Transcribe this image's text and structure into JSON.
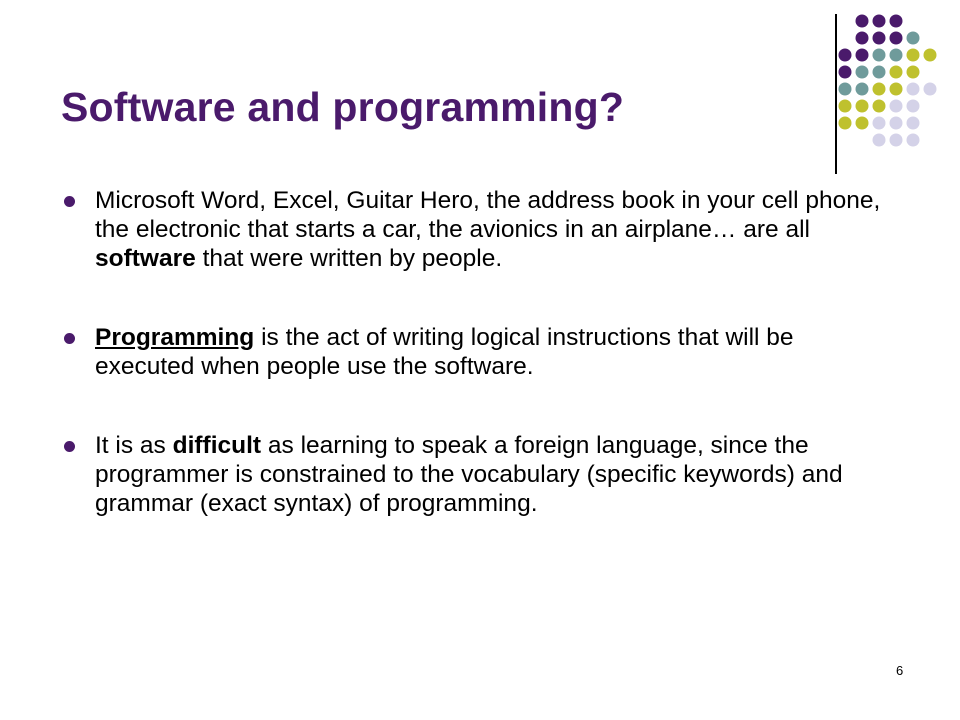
{
  "slide": {
    "title": "Software and programming?",
    "page_number": "6",
    "colors": {
      "title": "#4a1a6b",
      "dot_purple": "#4a1a6b",
      "dot_teal": "#6f9b9b",
      "dot_yellow": "#bfc12e",
      "dot_lavender": "#d4d2e8"
    },
    "bullets": [
      {
        "p1": "Microsoft Word, Excel, Guitar Hero, the address book in your cell phone, the electronic that starts a car, the avionics in an airplane… are all ",
        "b1": "software",
        "p2": " that were written by people."
      },
      {
        "u1": "Programming",
        "p1": " is the act of writing logical instructions that will be executed when people use the software."
      },
      {
        "p1": "It is as ",
        "b1": "difficult",
        "p2": " as learning to speak a foreign language, since the programmer is constrained to the vocabulary (specific keywords) and grammar (exact syntax) of programming."
      }
    ]
  }
}
